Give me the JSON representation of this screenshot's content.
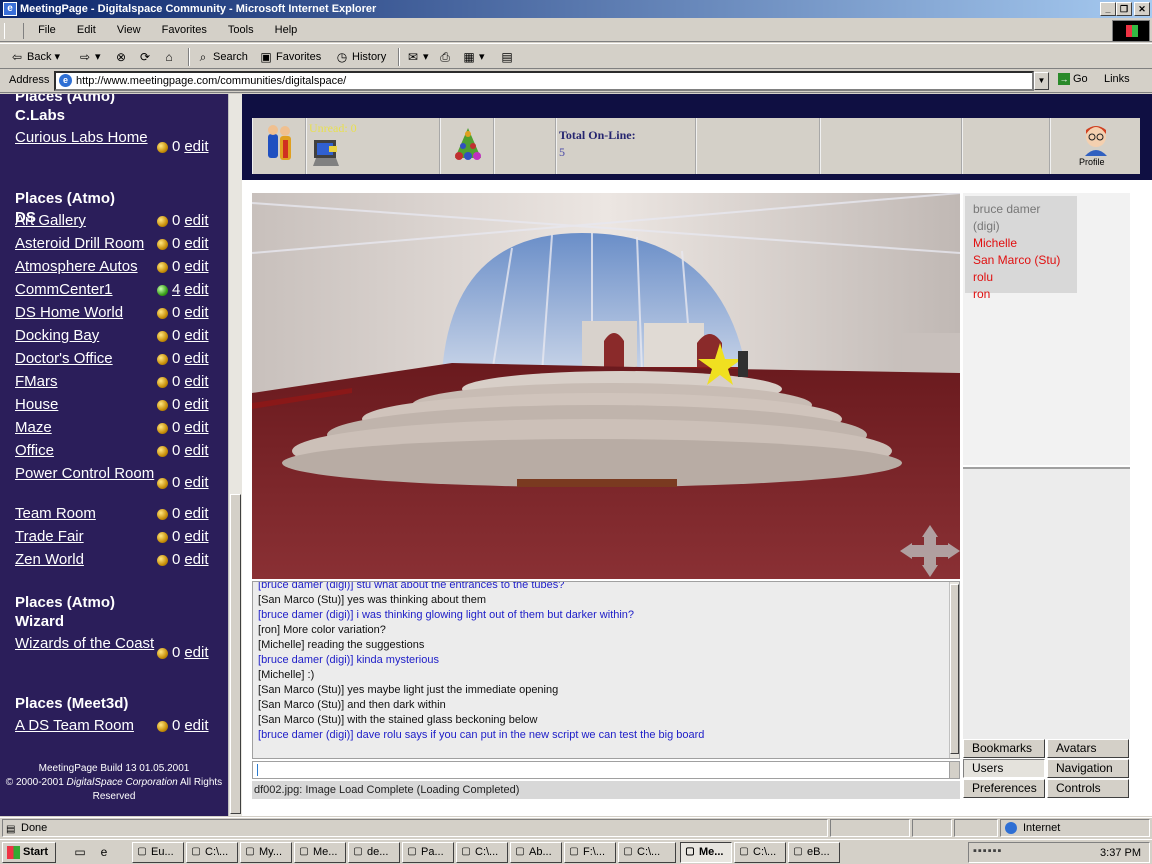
{
  "window": {
    "title": "MeetingPage - Digitalspace Community - Microsoft Internet Explorer",
    "minimize": "_",
    "restore": "❐",
    "close": "✕"
  },
  "menu": [
    "File",
    "Edit",
    "View",
    "Favorites",
    "Tools",
    "Help"
  ],
  "toolbar": {
    "back": "Back",
    "search": "Search",
    "favorites": "Favorites",
    "history": "History"
  },
  "address": {
    "label": "Address",
    "url": "http://www.meetingpage.com/communities/digitalspace/",
    "go": "Go",
    "links": "Links"
  },
  "sidebar": {
    "partial_heading": "Places (Atmo)",
    "sections": [
      {
        "heading": "C.Labs",
        "places": [
          {
            "name": "Curious Labs Home",
            "count": "0"
          }
        ]
      },
      {
        "heading": "Places (Atmo) DS",
        "places": [
          {
            "name": "Art Gallery",
            "count": "0"
          },
          {
            "name": "Asteroid Drill Room",
            "count": "0"
          },
          {
            "name": "Atmosphere Autos",
            "count": "0"
          },
          {
            "name": "CommCenter1",
            "count": "4",
            "active": true
          },
          {
            "name": "DS Home World",
            "count": "0"
          },
          {
            "name": "Docking Bay",
            "count": "0"
          },
          {
            "name": "Doctor's Office",
            "count": "0"
          },
          {
            "name": "FMars",
            "count": "0"
          },
          {
            "name": "House",
            "count": "0"
          },
          {
            "name": "Maze",
            "count": "0"
          },
          {
            "name": "Office",
            "count": "0"
          },
          {
            "name": "Power Control Room",
            "count": "0"
          },
          {
            "name": "Team Room",
            "count": "0"
          },
          {
            "name": "Trade Fair",
            "count": "0"
          },
          {
            "name": "Zen World",
            "count": "0"
          }
        ]
      },
      {
        "heading": "Places (Atmo) Wizard",
        "places": [
          {
            "name": "Wizards of the Coast",
            "count": "0"
          }
        ]
      },
      {
        "heading": "Places (Meet3d)",
        "places": [
          {
            "name": "A DS Team Room",
            "count": "0"
          }
        ]
      }
    ],
    "edit_label": "edit",
    "build": "MeetingPage Build 13  01.05.2001",
    "copyright_prefix": "© 2000-2001 ",
    "copyright_company": "DigitalSpace Corporation",
    "copyright_suffix": " All Rights Reserved"
  },
  "iconbar": {
    "unread": "Unread: 0",
    "online_label": "Total On-Line:",
    "online_count": "5",
    "profile": "Profile"
  },
  "users": [
    {
      "name": "bruce damer (digi)",
      "self": true
    },
    {
      "name": "Michelle"
    },
    {
      "name": "San Marco (Stu)"
    },
    {
      "name": "rolu"
    },
    {
      "name": "ron"
    }
  ],
  "tabs": [
    "Bookmarks",
    "Avatars",
    "Users",
    "Navigation",
    "Preferences",
    "Controls"
  ],
  "active_tab": "Users",
  "chat": [
    {
      "speaker": "bruce damer (digi)",
      "text": "stu what about the entrances to the tubes?",
      "self": true
    },
    {
      "speaker": "San Marco (Stu)",
      "text": "yes was thinking about them"
    },
    {
      "speaker": "bruce damer (digi)",
      "text": "i was thinking glowing light out of them but darker within?",
      "self": true
    },
    {
      "speaker": "ron",
      "text": "More color variation?"
    },
    {
      "speaker": "Michelle",
      "text": "reading the suggestions"
    },
    {
      "speaker": "bruce damer (digi)",
      "text": "kinda mysterious",
      "self": true
    },
    {
      "speaker": "Michelle",
      "text": ":)"
    },
    {
      "speaker": "San Marco (Stu)",
      "text": "yes maybe light just the immediate opening"
    },
    {
      "speaker": "San Marco (Stu)",
      "text": "and then dark within"
    },
    {
      "speaker": "San Marco (Stu)",
      "text": "with the stained glass beckoning below"
    },
    {
      "speaker": "bruce damer (digi)",
      "text": "dave rolu says if you can put in the new script we can test the big board",
      "self": true
    }
  ],
  "chat_input_value": "",
  "load_status": "df002.jpg: Image Load Complete (Loading Completed)",
  "statusbar": {
    "left": "Done",
    "zone": "Internet"
  },
  "taskbar": {
    "start": "Start",
    "tasks": [
      "Eu...",
      "C:\\...",
      "My...",
      "Me...",
      "de...",
      "Pa...",
      "C:\\...",
      "Ab...",
      "F:\\...",
      "C:\\...",
      "Me...",
      "C:\\...",
      "eB..."
    ],
    "active_index": 10,
    "clock": "3:37 PM"
  }
}
